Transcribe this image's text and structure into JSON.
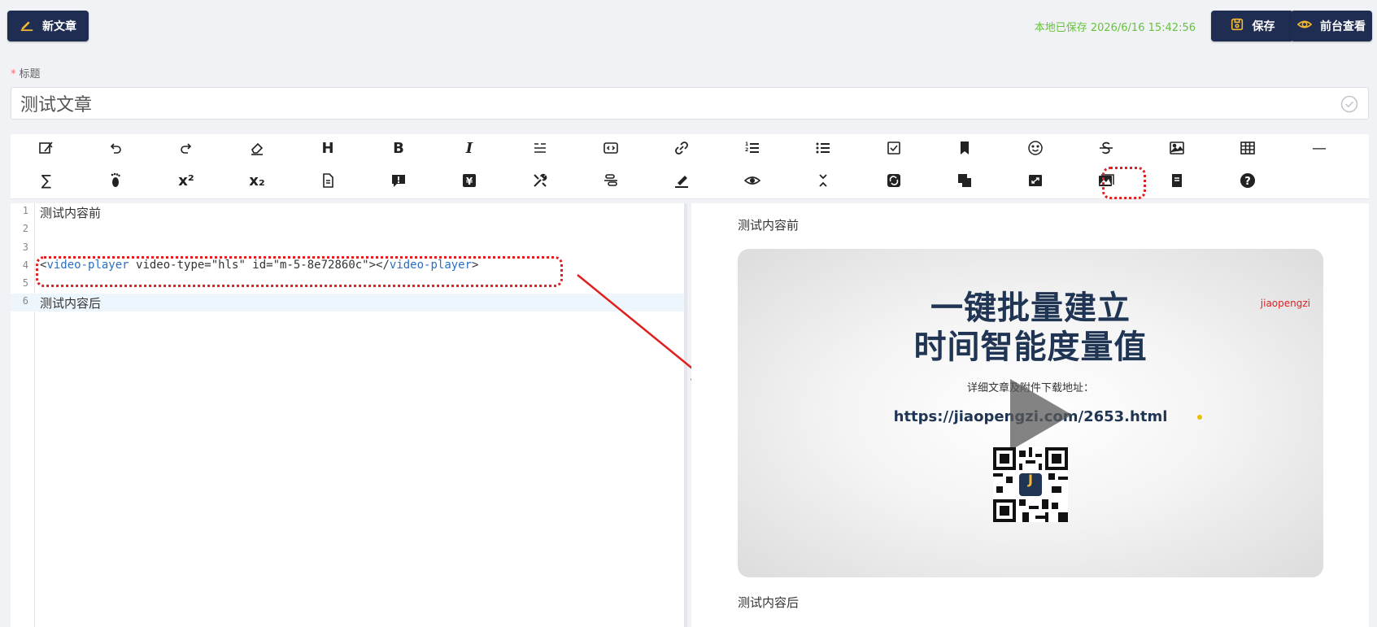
{
  "header": {
    "new_label": "新文章",
    "saved_status": "本地已保存 2026/6/16 15:42:56",
    "save_label": "保存",
    "view_label": "前台查看"
  },
  "form": {
    "title_label": "标题",
    "title_required_mark": "*",
    "title_value": "测试文章"
  },
  "toolbar": {
    "row1": [
      "magic-wand-icon",
      "undo-icon",
      "redo-icon",
      "eraser-icon",
      "heading-icon",
      "bold-icon",
      "italic-icon",
      "quote-icon",
      "code-block-icon",
      "link-icon",
      "ordered-list-icon",
      "unordered-list-icon",
      "checklist-icon",
      "bookmark-icon",
      "emoji-icon",
      "strikethrough-icon",
      "image-icon",
      "table-icon",
      "horizontal-rule-icon"
    ],
    "row2": [
      "formula-icon",
      "footnote-icon",
      "superscript-icon",
      "subscript-icon",
      "document-icon",
      "alert-icon",
      "currency-icon",
      "tools-icon",
      "align-icon",
      "highlighter-icon",
      "preview-icon",
      "collapse-icon",
      "sync-icon",
      "layers-icon",
      "fullscreen-icon",
      "gallery-icon",
      "note-icon",
      "help-icon"
    ],
    "heading_glyph": "H",
    "bold_glyph": "B",
    "italic_glyph": "I",
    "superscript_glyph": "x²",
    "subscript_glyph": "x₂",
    "formula_glyph": "∑",
    "hr_glyph": "—"
  },
  "editor": {
    "lines": [
      {
        "n": "1",
        "text": "测试内容前"
      },
      {
        "n": "2",
        "text": ""
      },
      {
        "n": "3",
        "text": ""
      },
      {
        "n": "4",
        "open_bracket": "<",
        "tag": "video-player",
        "attrs": " video-type=\"hls\" id=\"m-5-8e72860c\">",
        "close_open": "</",
        "close_tag": "video-player",
        "close_bracket": ">"
      },
      {
        "n": "5",
        "text": ""
      },
      {
        "n": "6",
        "text": "测试内容后"
      }
    ]
  },
  "preview": {
    "before": "测试内容前",
    "after": "测试内容后",
    "video": {
      "headline_1": "一键批量建立",
      "headline_2": "时间智能度量值",
      "brand": "jiaopengzi",
      "subtitle": "详细文章及附件下载地址：",
      "url": "https://jiaopengzi.com/2653.html",
      "qr_letter": "J"
    }
  },
  "colors": {
    "accent_dark": "#1f2d52",
    "saved_green": "#67c23a",
    "highlight_red": "#e02020",
    "tag_blue": "#2b6fc2"
  }
}
